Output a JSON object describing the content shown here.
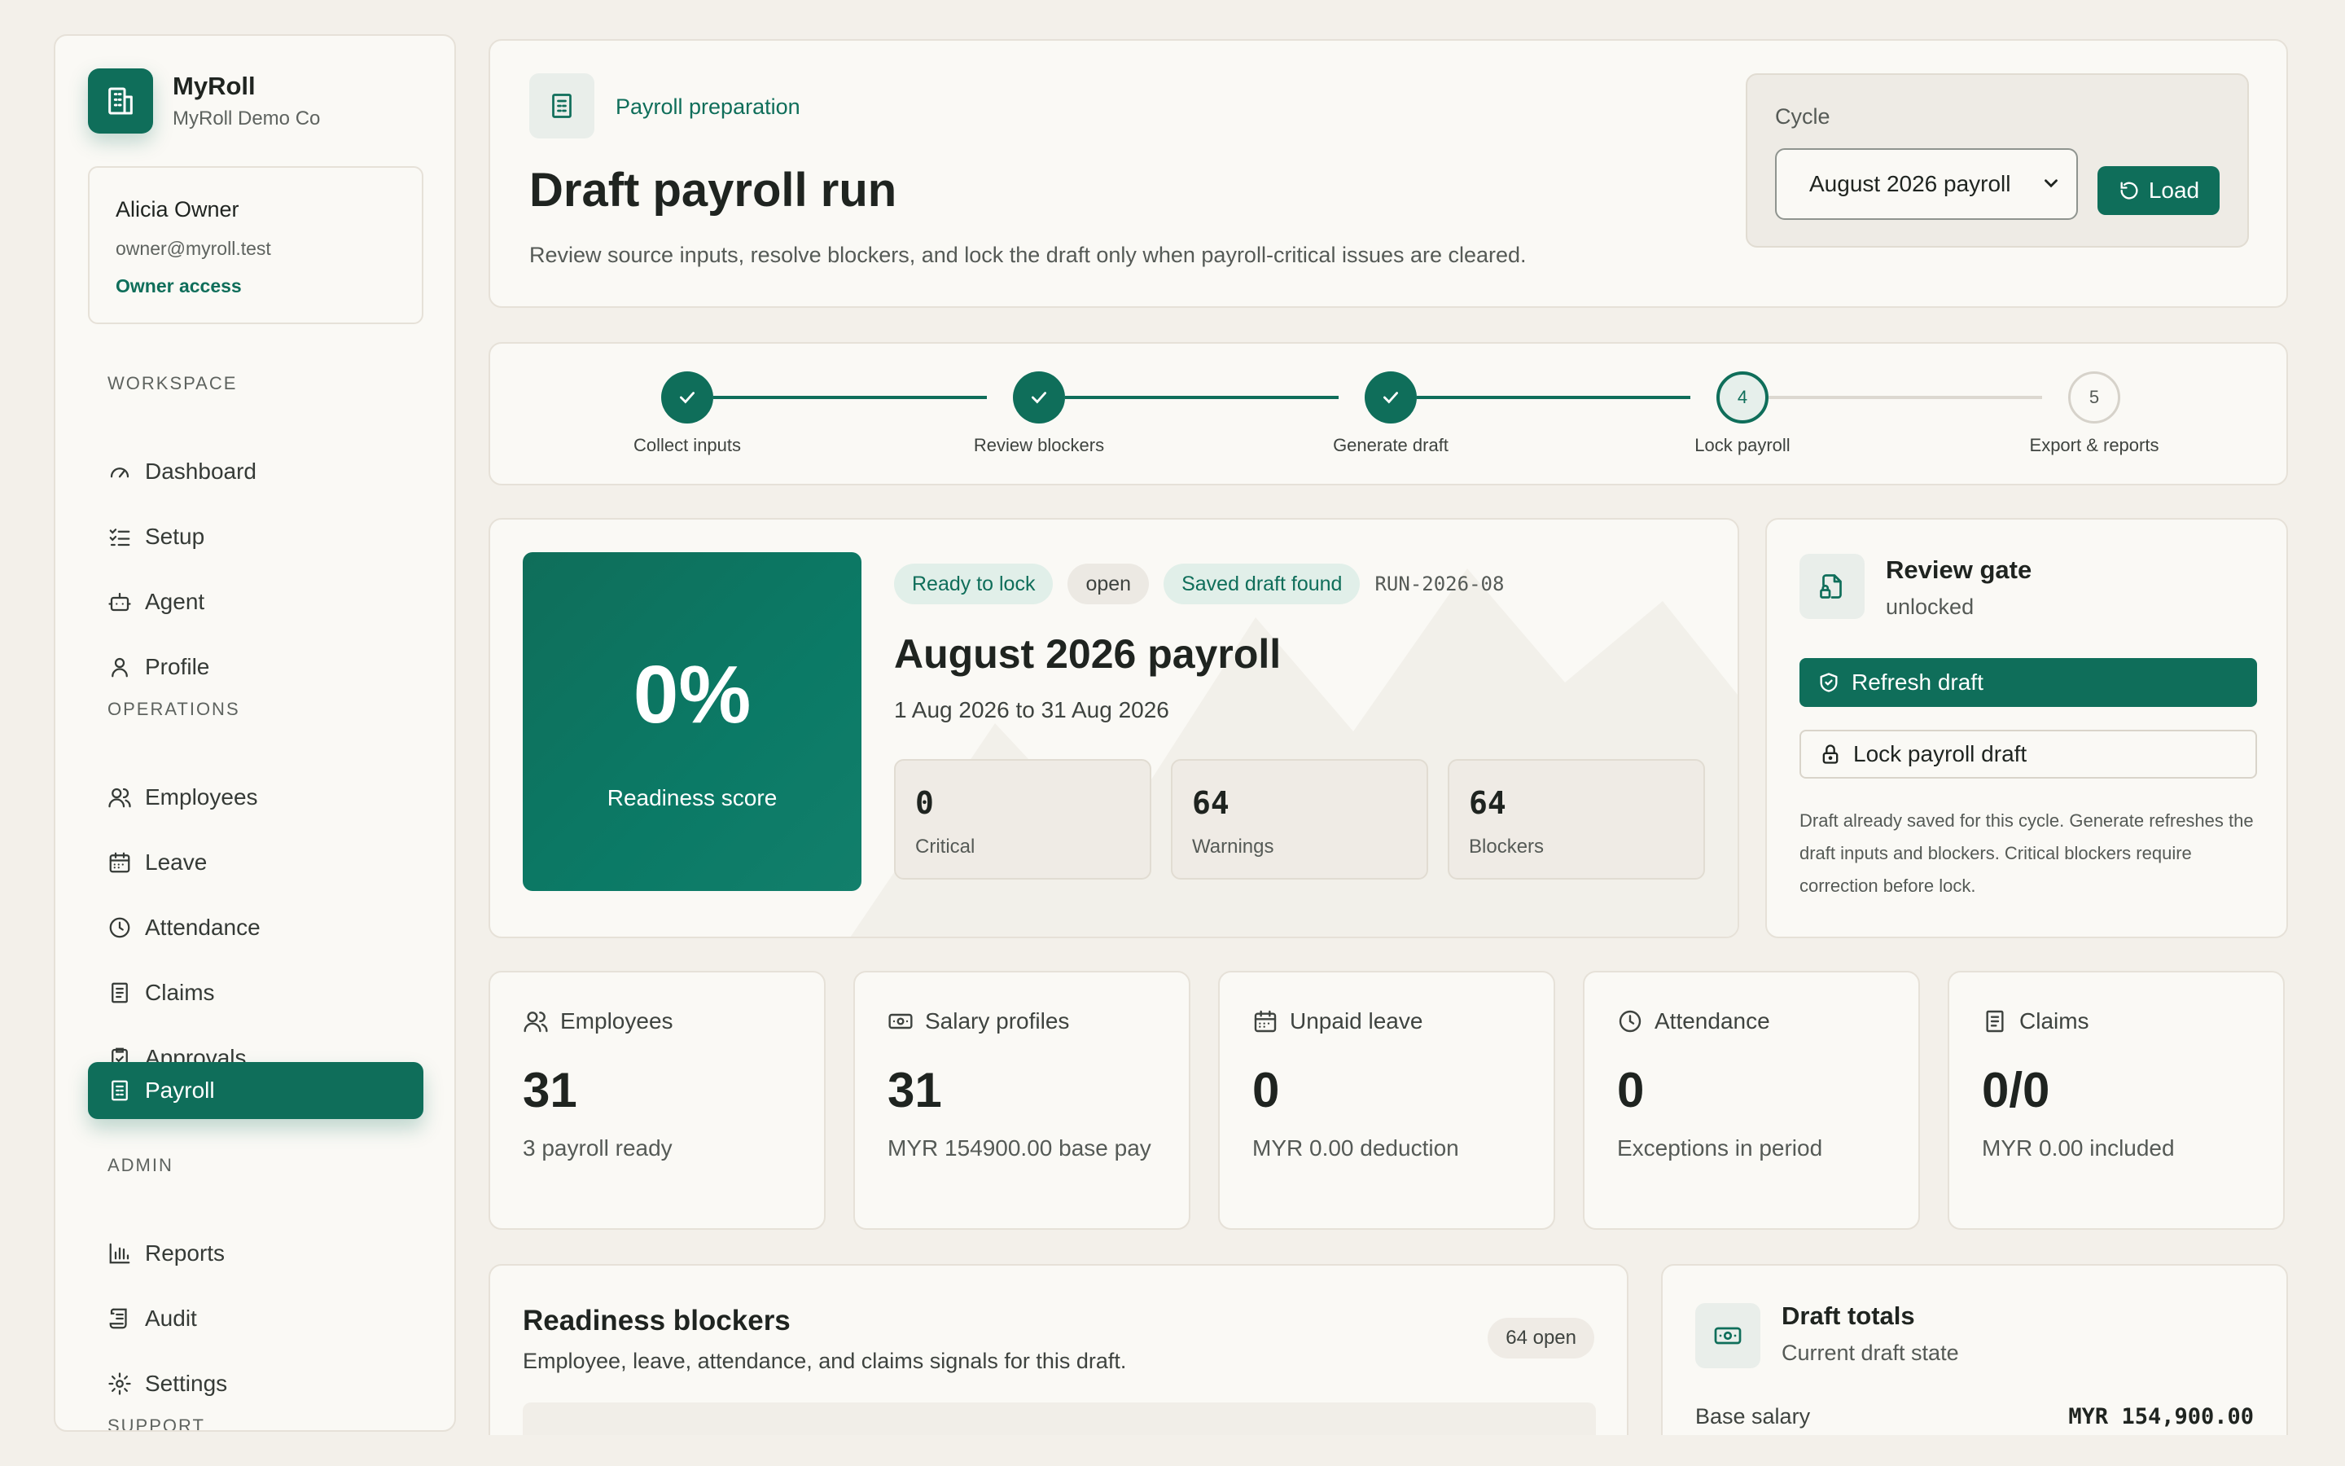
{
  "brand": {
    "name": "MyRoll",
    "company": "MyRoll Demo Co"
  },
  "user": {
    "name": "Alicia Owner",
    "email": "owner@myroll.test",
    "access": "Owner access"
  },
  "nav": {
    "workspace_label": "WORKSPACE",
    "operations_label": "OPERATIONS",
    "admin_label": "ADMIN",
    "support_label": "SUPPORT",
    "items": [
      {
        "label": "Dashboard",
        "icon": "gauge-icon"
      },
      {
        "label": "Setup",
        "icon": "checklist-icon"
      },
      {
        "label": "Agent",
        "icon": "robot-icon"
      },
      {
        "label": "Profile",
        "icon": "user-icon"
      },
      {
        "label": "Employees",
        "icon": "users-icon"
      },
      {
        "label": "Leave",
        "icon": "calendar-icon"
      },
      {
        "label": "Attendance",
        "icon": "clock-icon"
      },
      {
        "label": "Claims",
        "icon": "receipt-icon"
      },
      {
        "label": "Approvals",
        "icon": "clipboard-check-icon"
      },
      {
        "label": "Payroll",
        "icon": "payroll-doc-icon",
        "active": true
      },
      {
        "label": "Reports",
        "icon": "bar-chart-icon"
      },
      {
        "label": "Audit",
        "icon": "scroll-icon"
      },
      {
        "label": "Settings",
        "icon": "gear-icon"
      }
    ]
  },
  "header": {
    "eyebrow": "Payroll preparation",
    "title": "Draft payroll run",
    "description": "Review source inputs, resolve blockers, and lock the draft only when payroll-critical issues are cleared.",
    "cycle_label": "Cycle",
    "cycle_value": "August 2026 payroll",
    "load_label": "Load"
  },
  "stepper": {
    "steps": [
      {
        "label": "Collect inputs",
        "state": "done",
        "number": "1"
      },
      {
        "label": "Review blockers",
        "state": "done",
        "number": "2"
      },
      {
        "label": "Generate draft",
        "state": "done",
        "number": "3"
      },
      {
        "label": "Lock payroll",
        "state": "current",
        "number": "4"
      },
      {
        "label": "Export & reports",
        "state": "todo",
        "number": "5"
      }
    ]
  },
  "run": {
    "score": "0%",
    "score_label": "Readiness score",
    "badges": {
      "ready": "Ready to lock",
      "status": "open",
      "saved": "Saved draft found"
    },
    "run_id": "RUN-2026-08",
    "title": "August 2026 payroll",
    "range": "1 Aug 2026 to 31 Aug 2026",
    "stats": [
      {
        "value": "0",
        "label": "Critical"
      },
      {
        "value": "64",
        "label": "Warnings"
      },
      {
        "value": "64",
        "label": "Blockers"
      }
    ]
  },
  "gate": {
    "title": "Review gate",
    "state": "unlocked",
    "refresh_label": "Refresh draft",
    "lock_label": "Lock payroll draft",
    "note": "Draft already saved for this cycle. Generate refreshes the draft inputs and blockers. Critical blockers require correction before lock."
  },
  "metrics": [
    {
      "title": "Employees",
      "value": "31",
      "sub": "3 payroll ready",
      "icon": "users-icon"
    },
    {
      "title": "Salary profiles",
      "value": "31",
      "sub": "MYR 154900.00 base pay",
      "icon": "money-icon"
    },
    {
      "title": "Unpaid leave",
      "value": "0",
      "sub": "MYR 0.00 deduction",
      "icon": "calendar-icon"
    },
    {
      "title": "Attendance",
      "value": "0",
      "sub": "Exceptions in period",
      "icon": "clock-icon"
    },
    {
      "title": "Claims",
      "value": "0/0",
      "sub": "MYR 0.00 included",
      "icon": "receipt-icon"
    }
  ],
  "blockers": {
    "title": "Readiness blockers",
    "subtitle": "Employee, leave, attendance, and claims signals for this draft.",
    "badge": "64 open"
  },
  "totals": {
    "title": "Draft totals",
    "subtitle": "Current draft state",
    "rows": [
      {
        "label": "Base salary",
        "value": "MYR 154,900.00"
      }
    ]
  },
  "colors": {
    "accent": "#0f6e5a",
    "background": "#f3f0ea",
    "card": "#faf9f5"
  }
}
